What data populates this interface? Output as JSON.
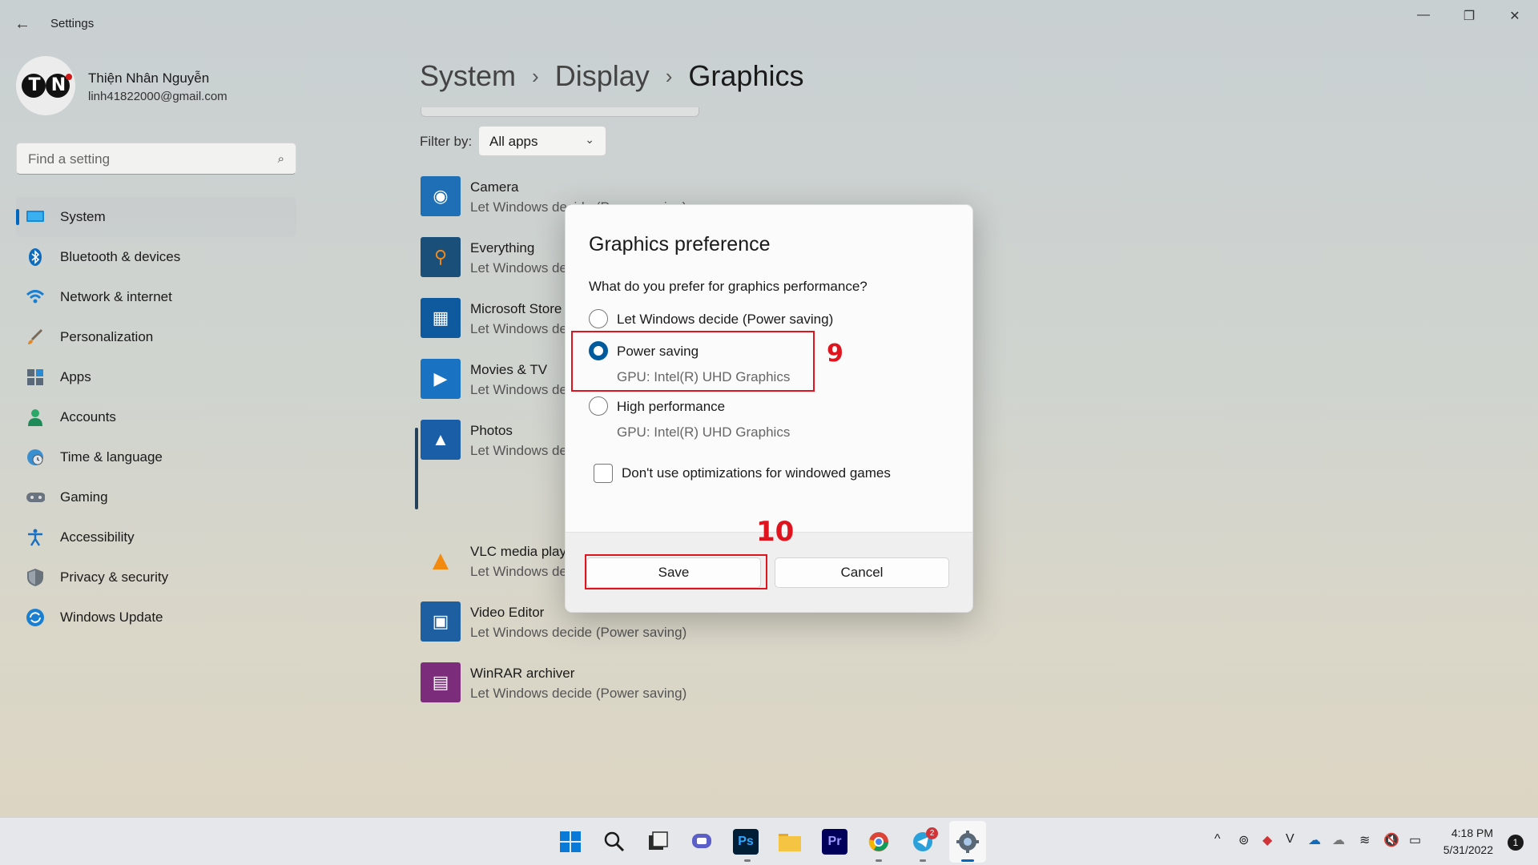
{
  "window": {
    "title": "Settings",
    "back_icon": "←",
    "min_icon": "—",
    "restore_icon": "❐",
    "close_icon": "✕"
  },
  "profile": {
    "name": "Thiện Nhân Nguyễn",
    "email": "linh41822000@gmail.com"
  },
  "search": {
    "placeholder": "Find a setting",
    "icon": "⌕"
  },
  "nav": [
    {
      "label": "System",
      "icon": "monitor-icon",
      "active": true
    },
    {
      "label": "Bluetooth & devices",
      "icon": "bluetooth-icon"
    },
    {
      "label": "Network & internet",
      "icon": "wifi-icon"
    },
    {
      "label": "Personalization",
      "icon": "brush-icon"
    },
    {
      "label": "Apps",
      "icon": "apps-icon"
    },
    {
      "label": "Accounts",
      "icon": "person-icon"
    },
    {
      "label": "Time & language",
      "icon": "globe-clock-icon"
    },
    {
      "label": "Gaming",
      "icon": "gamepad-icon"
    },
    {
      "label": "Accessibility",
      "icon": "accessibility-icon"
    },
    {
      "label": "Privacy & security",
      "icon": "shield-icon"
    },
    {
      "label": "Windows Update",
      "icon": "update-icon"
    }
  ],
  "breadcrumb": [
    "System",
    "Display",
    "Graphics"
  ],
  "breadcrumb_sep": "›",
  "filter": {
    "label": "Filter by:",
    "value": "All apps",
    "chevron": "⌄"
  },
  "apps": [
    {
      "name": "Camera",
      "sub": "Let Windows decide (Power saving)",
      "color": "#1e6fb5",
      "glyph": "◉"
    },
    {
      "name": "Everything",
      "sub": "Let Windows decide (Power saving)",
      "color": "#e07b12",
      "glyph": "⚲"
    },
    {
      "name": "Microsoft Store",
      "sub": "Let Windows decide (Power saving)",
      "color": "#0f5a9e",
      "glyph": "▦"
    },
    {
      "name": "Movies & TV",
      "sub": "Let Windows decide (Power saving)",
      "color": "#1a72c2",
      "glyph": "▶"
    },
    {
      "name": "Photos",
      "sub": "Let Windows decide (Power saving)",
      "color": "#1b5ea8",
      "glyph": "▲"
    },
    {
      "name": "VLC media player",
      "sub": "Let Windows decide (Power saving)",
      "color": "#e8e8e8",
      "glyph": "▲"
    },
    {
      "name": "Video Editor",
      "sub": "Let Windows decide (Power saving)",
      "color": "#1d5fa0",
      "glyph": "▣"
    },
    {
      "name": "WinRAR archiver",
      "sub": "Let Windows decide (Power saving)",
      "color": "#7b2d7b",
      "glyph": "▤"
    }
  ],
  "dialog": {
    "title": "Graphics preference",
    "question": "What do you prefer for graphics performance?",
    "options": [
      {
        "label": "Let Windows decide (Power saving)",
        "sub": "",
        "checked": false
      },
      {
        "label": "Power saving",
        "sub": "GPU: Intel(R) UHD Graphics",
        "checked": true
      },
      {
        "label": "High performance",
        "sub": "GPU: Intel(R) UHD Graphics",
        "checked": false
      }
    ],
    "checkbox_label": "Don't use optimizations for windowed games",
    "checkbox_checked": false,
    "save_label": "Save",
    "cancel_label": "Cancel"
  },
  "annotations": {
    "step_a": "9",
    "step_b": "10",
    "color": "#e0141e"
  },
  "taskbar": {
    "apps": [
      {
        "name": "start-icon",
        "glyph": "⊞",
        "color": "#0078d4"
      },
      {
        "name": "search-icon",
        "glyph": "⌕",
        "color": "#1a1a1a"
      },
      {
        "name": "task-view-icon",
        "glyph": "❐",
        "color": "#1a1a1a"
      },
      {
        "name": "chat-icon",
        "glyph": "◙",
        "color": "#5b5fc7"
      },
      {
        "name": "photoshop-icon",
        "glyph": "Ps",
        "color": "#31a8ff"
      },
      {
        "name": "file-explorer-icon",
        "glyph": "▬",
        "color": "#f2b72e"
      },
      {
        "name": "premiere-icon",
        "glyph": "Pr",
        "color": "#9999ff"
      },
      {
        "name": "chrome-icon",
        "glyph": "◉",
        "color": "#2a9d46"
      },
      {
        "name": "telegram-icon",
        "glyph": "➤",
        "color": "#2aa1da"
      },
      {
        "name": "settings-icon",
        "glyph": "⚙",
        "color": "#4a5a6a"
      }
    ],
    "telegram_badge": "2",
    "tray": [
      "^",
      "⊚",
      "◆",
      "V",
      "☁",
      "☁",
      "≋",
      "🔇",
      "▭"
    ],
    "time": "4:18 PM",
    "date": "5/31/2022",
    "notifications": "1"
  }
}
